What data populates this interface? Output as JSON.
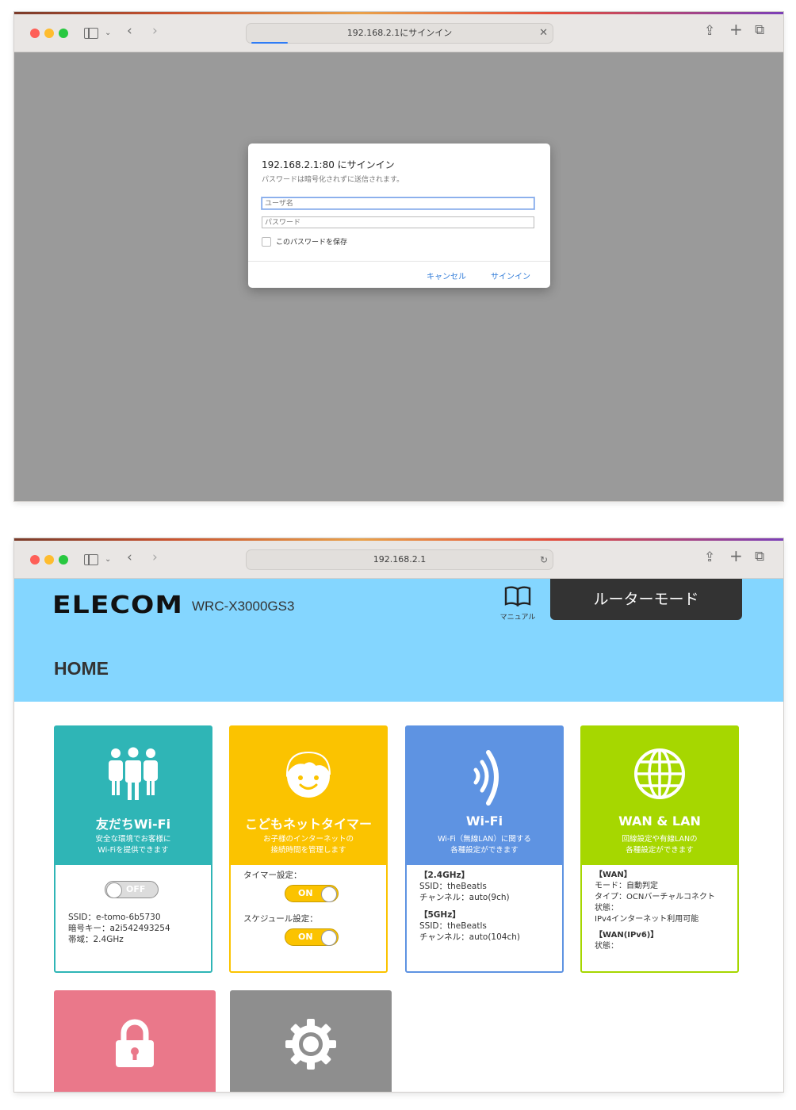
{
  "window1": {
    "address": "192.168.2.1にサインイン",
    "dialog": {
      "title": "192.168.2.1:80 にサインイン",
      "subtitle": "パスワードは暗号化されずに送信されます。",
      "username_placeholder": "ユーザ名",
      "password_placeholder": "パスワード",
      "save_label": "このパスワードを保存",
      "cancel_label": "キャンセル",
      "signin_label": "サインイン"
    }
  },
  "window2": {
    "address": "192.168.2.1",
    "header": {
      "brand": "ELECOM",
      "model": "WRC-X3000GS3",
      "manual_label": "マニュアル",
      "mode_label": "ルーターモード",
      "page_title": "HOME"
    },
    "cards": {
      "friends_wifi": {
        "name": "友だちWi-Fi",
        "desc1": "安全な環境でお客様に",
        "desc2": "Wi-Fiを提供できます",
        "toggle": "OFF",
        "ssid": "SSID：e-tomo-6b5730",
        "key": "暗号キー：a2i542493254",
        "band": "帯域：2.4GHz"
      },
      "kids_timer": {
        "name": "こどもネットタイマー",
        "desc1": "お子様のインターネットの",
        "desc2": "接続時間を管理します",
        "timer_label": "タイマー設定：",
        "timer_toggle": "ON",
        "schedule_label": "スケジュール設定：",
        "schedule_toggle": "ON"
      },
      "wifi": {
        "name": "Wi-Fi",
        "desc1": "Wi-Fi（無線LAN）に関する",
        "desc2": "各種設定ができます",
        "h24": "【2.4GHz】",
        "ssid24": "SSID：theBeatls",
        "ch24": "チャンネル：auto(9ch)",
        "h5": "【5GHz】",
        "ssid5": "SSID：theBeatls",
        "ch5": "チャンネル：auto(104ch)"
      },
      "wan_lan": {
        "name": "WAN & LAN",
        "desc1": "回線設定や有線LANの",
        "desc2": "各種設定ができます",
        "h_wan": "【WAN】",
        "mode": "モード：自動判定",
        "type": "タイプ：OCNバーチャルコネクト",
        "status_label": "状態：",
        "status": "IPv4インターネット利用可能",
        "h_wan6": "【WAN(IPv6)】",
        "status6_label": "状態："
      }
    }
  }
}
